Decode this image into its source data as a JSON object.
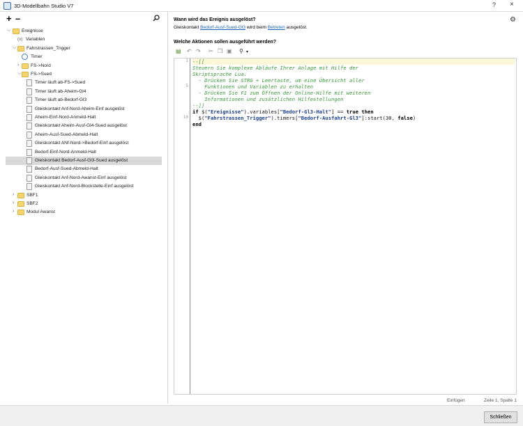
{
  "window": {
    "title": "3D-Modellbahn Studio V7",
    "help_label": "?",
    "close_label": "×"
  },
  "left_toolbar": {
    "add_label": "+",
    "remove_label": "–"
  },
  "tree": {
    "nodes": [
      {
        "label": "Ereignisse",
        "icon": "folder-icon",
        "expanded": true
      },
      {
        "label": "Variablen",
        "icon": "variable-icon",
        "symbol": "(x)"
      },
      {
        "label": "Fahrstrassen_Trigger",
        "icon": "folder-icon",
        "expanded": true
      },
      {
        "label": "Timer",
        "icon": "clock-icon"
      },
      {
        "label": "FS->Nord",
        "icon": "folder-icon",
        "expanded": false
      },
      {
        "label": "FS->Sued",
        "icon": "folder-icon",
        "expanded": true
      },
      {
        "label": "Timer läuft ab-FS->Sued",
        "icon": "event-icon"
      },
      {
        "label": "Timer läuft ab-Aheim-Gl4",
        "icon": "event-icon"
      },
      {
        "label": "Timer läuft ab-Bedorf-Gl3",
        "icon": "event-icon"
      },
      {
        "label": "Gleiskontakt Anf-Nord-Aheim-Einf ausgelöst",
        "icon": "event-icon"
      },
      {
        "label": "Aheim-Einf-Nord-Anmeld-Halt",
        "icon": "event-icon"
      },
      {
        "label": "Gleiskontakt Aheim-Ausf-Gl4-Sued ausgelöst",
        "icon": "event-icon"
      },
      {
        "label": "Aheim-Ausf-Sued-Abmeld-Halt",
        "icon": "event-icon"
      },
      {
        "label": "Gleiskontakt ANf-Nord->Bedorf-Einf ausgelöst",
        "icon": "event-icon"
      },
      {
        "label": "Bedorf-Einf-Nord-Anmeld-Halt",
        "icon": "event-icon"
      },
      {
        "label": "Gleiskontakt Bedorf-Ausf-Gl3-Sued ausgelöst",
        "icon": "event-icon",
        "selected": true
      },
      {
        "label": "Bedorf-Ausf-Sued-Abmeld-Halt",
        "icon": "event-icon"
      },
      {
        "label": "Gleiskontakt Anf-Nord-Awanst-Einf ausgelöst",
        "icon": "event-icon"
      },
      {
        "label": "Gleiskontakt Anf-Nord-Blockstelle-Einf ausgelöst",
        "icon": "event-icon"
      },
      {
        "label": "SBF1",
        "icon": "folder-icon",
        "expanded": false
      },
      {
        "label": "SBF2",
        "icon": "folder-icon",
        "expanded": false
      },
      {
        "label": "Modul Awanst",
        "icon": "folder-icon",
        "expanded": false
      }
    ]
  },
  "trigger": {
    "question": "Wann wird das Ereignis ausgelöst?",
    "prefix": "Gleiskontakt ",
    "link1": "Bedorf-Ausf-Sued-Gl3",
    "middle": " wird beim ",
    "link2": "Betreten",
    "suffix": " ausgelöst."
  },
  "actions": {
    "question": "Welche Aktionen sollen ausgeführt werden?"
  },
  "editor": {
    "gutter": [
      "1",
      "",
      "",
      "",
      "5",
      "",
      "",
      "",
      "",
      "10",
      ""
    ],
    "lines": [
      [
        {
          "t": "--[[",
          "c": "cmt"
        }
      ],
      [
        {
          "t": "Steuern Sie komplexe Abläufe Ihrer Anlage mit Hilfe der",
          "c": "cmt"
        }
      ],
      [
        {
          "t": "Skriptsprache Lua:",
          "c": "cmt"
        }
      ],
      [
        {
          "t": "  - Drücken Sie STRG + Leertaste, um eine Übersicht aller",
          "c": "cmt"
        }
      ],
      [
        {
          "t": "    Funktionen und Variablen zu erhalten",
          "c": "cmt"
        }
      ],
      [
        {
          "t": "  - Drücken Sie F1 zum Öffnen der Online-Hilfe mit weiteren",
          "c": "cmt"
        }
      ],
      [
        {
          "t": "    Informationen und zusätzlichen Hilfestellungen",
          "c": "cmt"
        }
      ],
      [
        {
          "t": "--]]",
          "c": "cmt"
        }
      ],
      [
        {
          "t": "if ",
          "c": "kw"
        },
        {
          "t": "$(",
          "c": "plain"
        },
        {
          "t": "\"Ereignisse\"",
          "c": "str"
        },
        {
          "t": ").variables[",
          "c": "plain"
        },
        {
          "t": "\"Bedorf-Gl3-Halt\"",
          "c": "str"
        },
        {
          "t": "] == ",
          "c": "plain"
        },
        {
          "t": "true then",
          "c": "kw"
        }
      ],
      [
        {
          "t": "  $(",
          "c": "plain"
        },
        {
          "t": "\"Fahrstrassen_Trigger\"",
          "c": "str"
        },
        {
          "t": ").timers[",
          "c": "plain"
        },
        {
          "t": "\"Bedorf-Ausfahrt-Gl3\"",
          "c": "str"
        },
        {
          "t": "]:start(30, ",
          "c": "plain"
        },
        {
          "t": "false",
          "c": "kw"
        },
        {
          "t": ")",
          "c": "plain"
        }
      ],
      [
        {
          "t": "end",
          "c": "kw"
        }
      ]
    ]
  },
  "status": {
    "mode": "Einfügen",
    "position": "Zeile 1, Spalte 1"
  },
  "footer": {
    "close_label": "Schließen"
  }
}
